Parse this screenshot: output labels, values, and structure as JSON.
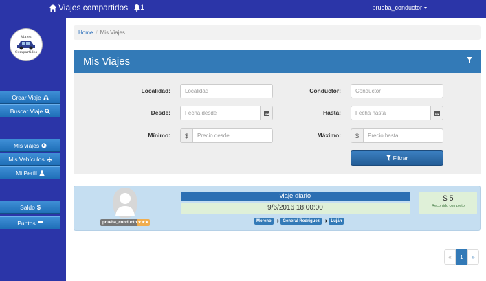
{
  "navbar": {
    "brand": "Viajes compartidos",
    "notifications_count": "1",
    "user": "prueba_conductor"
  },
  "sidebar": {
    "logo_text_top": "Viajes",
    "logo_text_bottom": "Compartidos",
    "buttons": [
      {
        "label": "Crear Viaje",
        "icon": "road-icon"
      },
      {
        "label": "Buscar Viaje",
        "icon": "search-icon"
      },
      {
        "label": "Mis viajes",
        "icon": "globe-icon"
      },
      {
        "label": "Mis Vehículos",
        "icon": "plane-icon"
      },
      {
        "label": "Mi Perfil",
        "icon": "user-icon"
      },
      {
        "label": "Saldo",
        "icon": "dollar-icon"
      },
      {
        "label": "Puntos",
        "icon": "card-icon"
      }
    ]
  },
  "breadcrumb": {
    "home": "Home",
    "current": "Mis Viajes"
  },
  "panel": {
    "title": "Mis Viajes"
  },
  "filters": {
    "localidad": {
      "label": "Localidad:",
      "placeholder": "Localidad"
    },
    "conductor": {
      "label": "Conductor:",
      "placeholder": "Conductor"
    },
    "desde": {
      "label": "Desde:",
      "placeholder": "Fecha desde"
    },
    "hasta": {
      "label": "Hasta:",
      "placeholder": "Fecha hasta"
    },
    "minimo": {
      "label": "Mínimo:",
      "placeholder": "Precio desde",
      "addon": "$"
    },
    "maximo": {
      "label": "Máximo:",
      "placeholder": "Precio hasta",
      "addon": "$"
    },
    "submit": "Filtrar"
  },
  "trip": {
    "driver": "prueba_conductor",
    "rating": "★★★",
    "title": "viaje diario",
    "date": "9/6/2016 18:00:00",
    "route": [
      "Moreno",
      "General Rodriguez",
      "Luján"
    ],
    "price": "$ 5",
    "price_note": "Recorrido completo"
  },
  "pagination": {
    "prev": "«",
    "current": "1",
    "next": "»"
  },
  "colors": {
    "navbar": "#2b35a8",
    "panel_header": "#337ab7",
    "trip_card": "#c5def1"
  }
}
